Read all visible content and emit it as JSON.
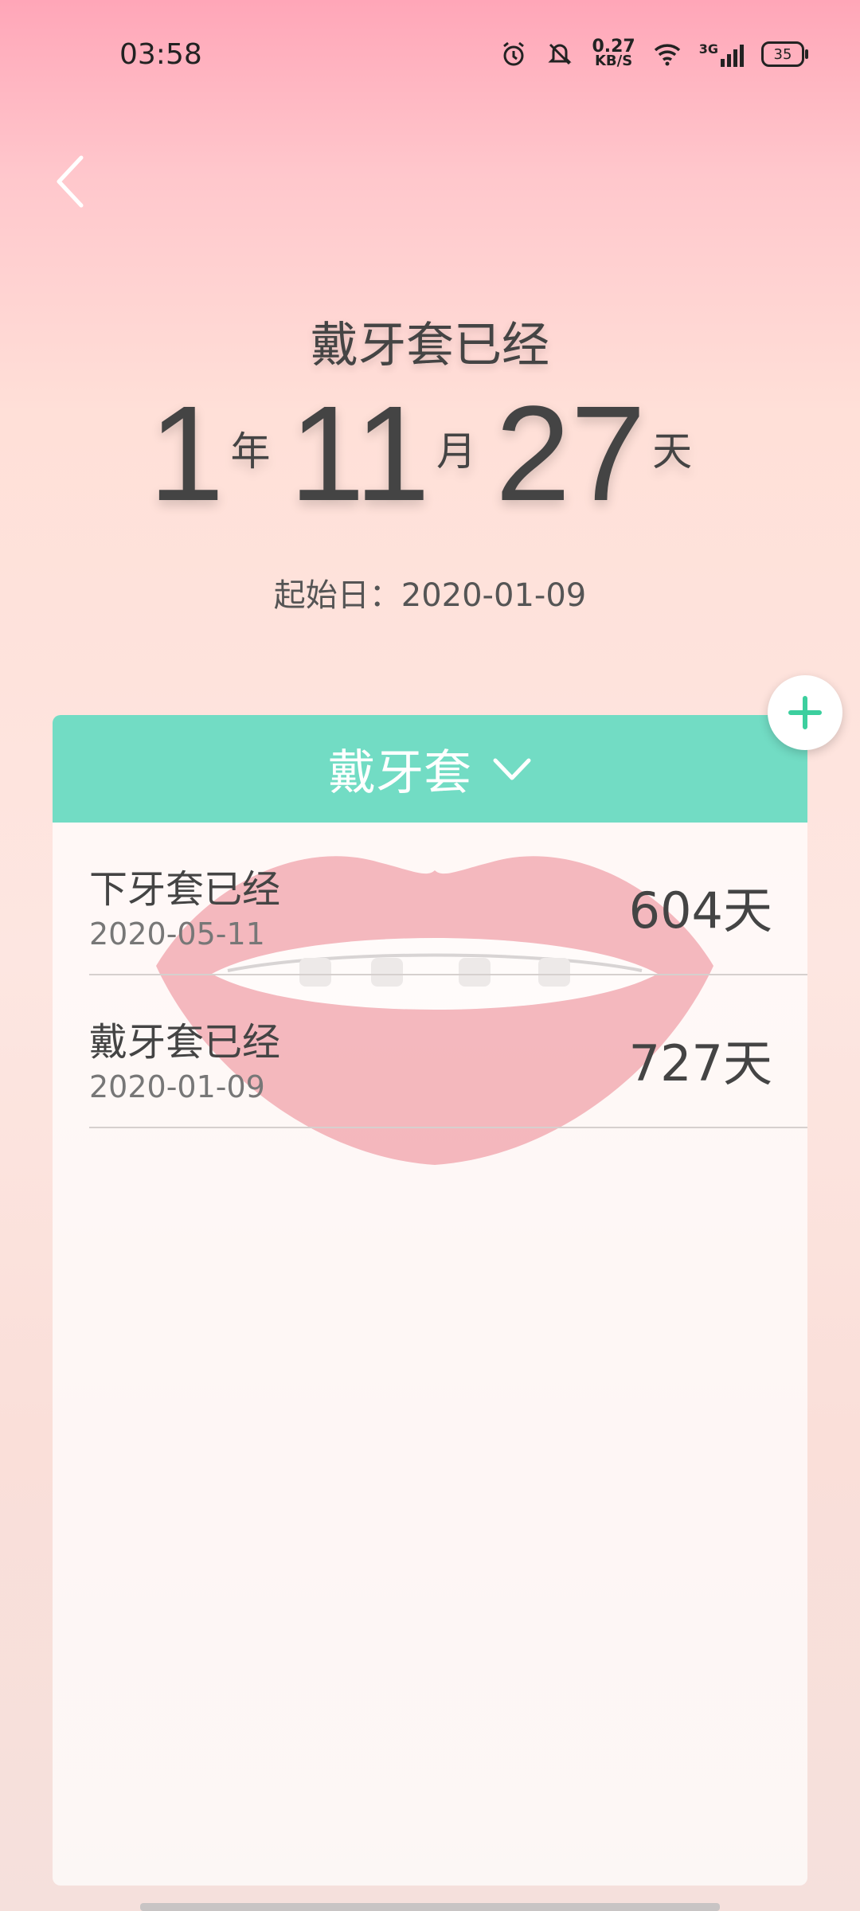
{
  "status": {
    "time": "03:58",
    "net_speed": "0.27",
    "net_unit": "KB/S",
    "signal": "3G",
    "battery": "35"
  },
  "header": {
    "title": "戴牙套已经"
  },
  "counter": {
    "years": "1",
    "years_unit": "年",
    "months": "11",
    "months_unit": "月",
    "days": "27",
    "days_unit": "天"
  },
  "start": {
    "text": "起始日：2020-01-09"
  },
  "card": {
    "header_label": "戴牙套",
    "items": [
      {
        "label": "下牙套已经",
        "date": "2020-05-11",
        "days": "604天"
      },
      {
        "label": "戴牙套已经",
        "date": "2020-01-09",
        "days": "727天"
      }
    ]
  },
  "colors": {
    "accent": "#72dcc4",
    "plus": "#3ccf9e"
  },
  "icons": [
    "back-icon",
    "chevron-down-icon",
    "plus-icon",
    "alarm-icon",
    "mute-icon",
    "wifi-icon",
    "battery-icon"
  ]
}
